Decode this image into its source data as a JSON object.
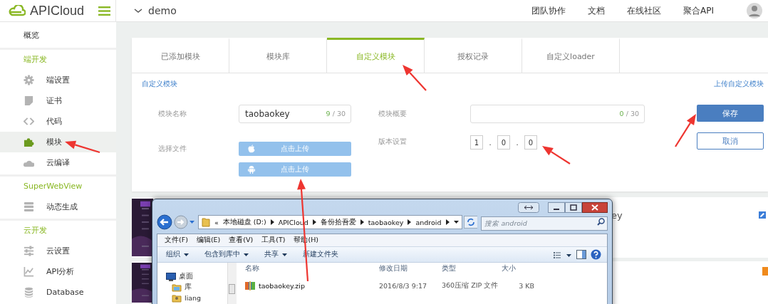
{
  "header": {
    "brand": "APICloud",
    "project": "demo",
    "nav": [
      "团队协作",
      "文档",
      "在线社区",
      "聚合API"
    ]
  },
  "sidebar": {
    "sections": [
      {
        "items": [
          {
            "label": "概览",
            "selected": false
          }
        ]
      },
      {
        "title": "端开发",
        "items": [
          {
            "label": "端设置",
            "selected": false
          },
          {
            "label": "证书",
            "selected": false
          },
          {
            "label": "代码",
            "selected": false
          },
          {
            "label": "模块",
            "selected": true
          },
          {
            "label": "云编译",
            "selected": false
          }
        ]
      },
      {
        "title": "SuperWebView",
        "items": [
          {
            "label": "动态生成",
            "selected": false
          }
        ]
      },
      {
        "title": "云开发",
        "items": [
          {
            "label": "云设置",
            "selected": false
          },
          {
            "label": "API分析",
            "selected": false
          },
          {
            "label": "Database",
            "selected": false
          }
        ]
      }
    ]
  },
  "tabs": [
    {
      "label": "已添加模块",
      "selected": false
    },
    {
      "label": "模块库",
      "selected": false
    },
    {
      "label": "自定义模块",
      "selected": true
    },
    {
      "label": "授权记录",
      "selected": false
    },
    {
      "label": "自定义loader",
      "selected": false
    }
  ],
  "form": {
    "breadcrumb": "自定义模块",
    "upload_link": "上传自定义模块",
    "name": {
      "label": "模块名称",
      "value": "taobaokey",
      "count": "9",
      "limit": "/ 30"
    },
    "summary": {
      "label": "模块概要",
      "count": "0",
      "limit": "/ 30"
    },
    "file": {
      "label": "选择文件",
      "buttons": [
        "点击上传",
        "点击上传"
      ]
    },
    "version": {
      "label": "版本设置",
      "parts": [
        {
          "kind": "field",
          "text": "1"
        },
        {
          "kind": "dot",
          "text": "."
        },
        {
          "kind": "field",
          "text": "0"
        },
        {
          "kind": "dot",
          "text": "."
        },
        {
          "kind": "field",
          "text": "0"
        }
      ]
    },
    "save": "保存",
    "cancel": "取消"
  },
  "list": {
    "rows": [
      {
        "kind": "picture",
        "title_fragment": "ey"
      },
      {
        "kind": "picture"
      }
    ]
  },
  "explorer": {
    "overflow_mark": "«",
    "path": [
      "本地磁盘 (D:)",
      "APICloud",
      "备份拾吾爱",
      "taobaokey",
      "android"
    ],
    "search_placeholder": "搜索 android",
    "menu": [
      "文件(F)",
      "编辑(E)",
      "查看(V)",
      "工具(T)",
      "帮助(H)"
    ],
    "toolbar": [
      {
        "label": "组织",
        "dropdown": true
      },
      {
        "label": "包含到库中",
        "dropdown": true
      },
      {
        "label": "共享",
        "dropdown": true
      },
      {
        "label": "新建文件夹",
        "dropdown": false
      }
    ],
    "tree": [
      "桌面",
      "库",
      "liang"
    ],
    "columns": [
      "名称",
      "修改日期",
      "类型",
      "大小"
    ],
    "files": [
      {
        "name": "taobaokey.zip",
        "date": "2016/8/3 9:17",
        "type": "360压缩 ZIP 文件",
        "size": "3 KB"
      }
    ]
  }
}
